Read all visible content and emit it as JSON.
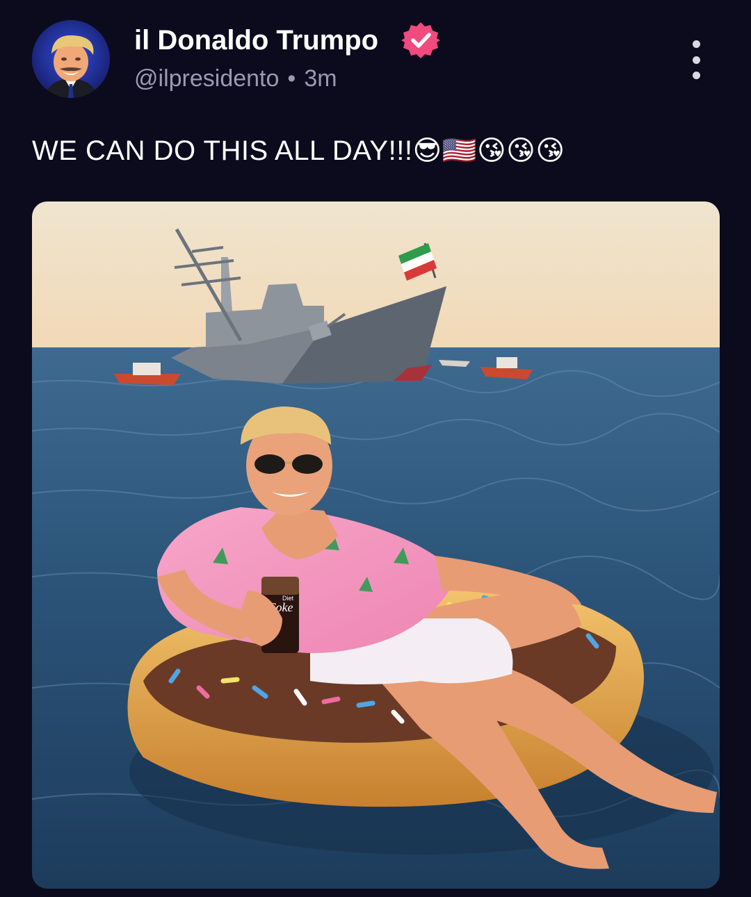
{
  "post": {
    "author": {
      "display_name": "il Donaldo Trumpo",
      "handle": "@ilpresidento",
      "verified": true,
      "avatar_icon": "avatar-photo"
    },
    "separator": "•",
    "timestamp": "3m",
    "text": "WE CAN DO THIS ALL DAY!!!",
    "emojis": "😎🇺🇸😘😘😘",
    "more_icon": "more-vertical-icon",
    "media": {
      "cup_brand": "Coke",
      "cup_subbrand": "Diet"
    }
  },
  "colors": {
    "background": "#0c0b1d",
    "verified_badge": "#f04a7e",
    "handle_text": "#9b9ab2"
  }
}
